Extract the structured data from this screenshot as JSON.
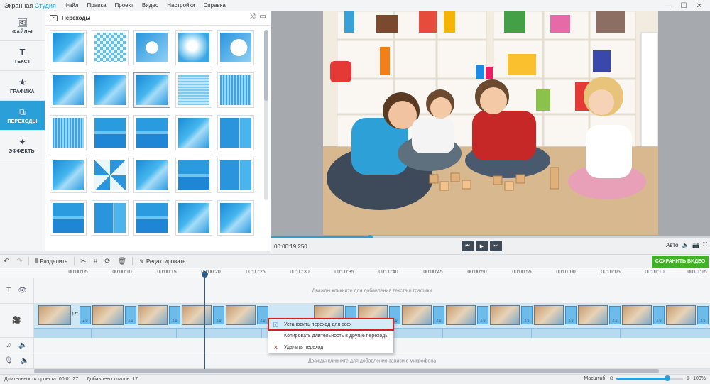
{
  "app": {
    "title_main": "Экранная ",
    "title_accent": "Студия",
    "menu": [
      "Файл",
      "Правка",
      "Проект",
      "Видео",
      "Настройки",
      "Справка"
    ],
    "win_controls": [
      "—",
      "☐",
      "✕"
    ]
  },
  "sidebar": {
    "items": [
      {
        "label": "ФАЙЛЫ",
        "icon": "image-icon",
        "active": false
      },
      {
        "label": "ТЕКСТ",
        "icon": "text-icon",
        "active": false
      },
      {
        "label": "ГРАФИКА",
        "icon": "star-icon",
        "active": false
      },
      {
        "label": "ПЕРЕХОДЫ",
        "icon": "transitions-icon",
        "active": true
      },
      {
        "label": "ЭФФЕКТЫ",
        "icon": "wand-icon",
        "active": false
      }
    ]
  },
  "panel": {
    "title": "Переходы"
  },
  "player": {
    "timecode": "00:00:19.250",
    "auto_label": "Авто",
    "progress_fraction": 0.225
  },
  "toolbar": {
    "split_label": "Разделить",
    "edit_label": "Редактировать",
    "save_label": "СОХРАНИТЬ ВИДЕО"
  },
  "ruler": {
    "ticks": [
      "00:00:05",
      "00:00:10",
      "00:00:15",
      "00:00:20",
      "00:00:25",
      "00:00:30",
      "00:00:35",
      "00:00:40",
      "00:00:45",
      "00:00:50",
      "00:00:55",
      "00:01:00",
      "00:01:05",
      "00:01:10",
      "00:01:15"
    ]
  },
  "tracks": {
    "text_hint": "Дважды кликните для добавления текста и графики",
    "music_hint": "ния музыки",
    "mic_hint": "Дважды кликните для добавления записи с микрофона",
    "transition_duration": "2.0",
    "clip_label": "ре"
  },
  "context_menu": {
    "items": [
      {
        "label": "Установить переход для всех",
        "icon": "checkbox-icon"
      },
      {
        "label": "Копировать длительность  в другие переходы",
        "icon": ""
      },
      {
        "label": "Удалить переход",
        "icon": "delete-icon"
      }
    ]
  },
  "status": {
    "duration_label": "Длительность проекта:",
    "duration_value": "00:01:27",
    "clips_label": "Добавлено клипов:",
    "clips_value": "17",
    "zoom_label": "Масштаб:",
    "zoom_value": "100%"
  },
  "colors": {
    "accent": "#2a9fd8",
    "save_green": "#43b02a",
    "highlight_red": "#d81e1e"
  }
}
